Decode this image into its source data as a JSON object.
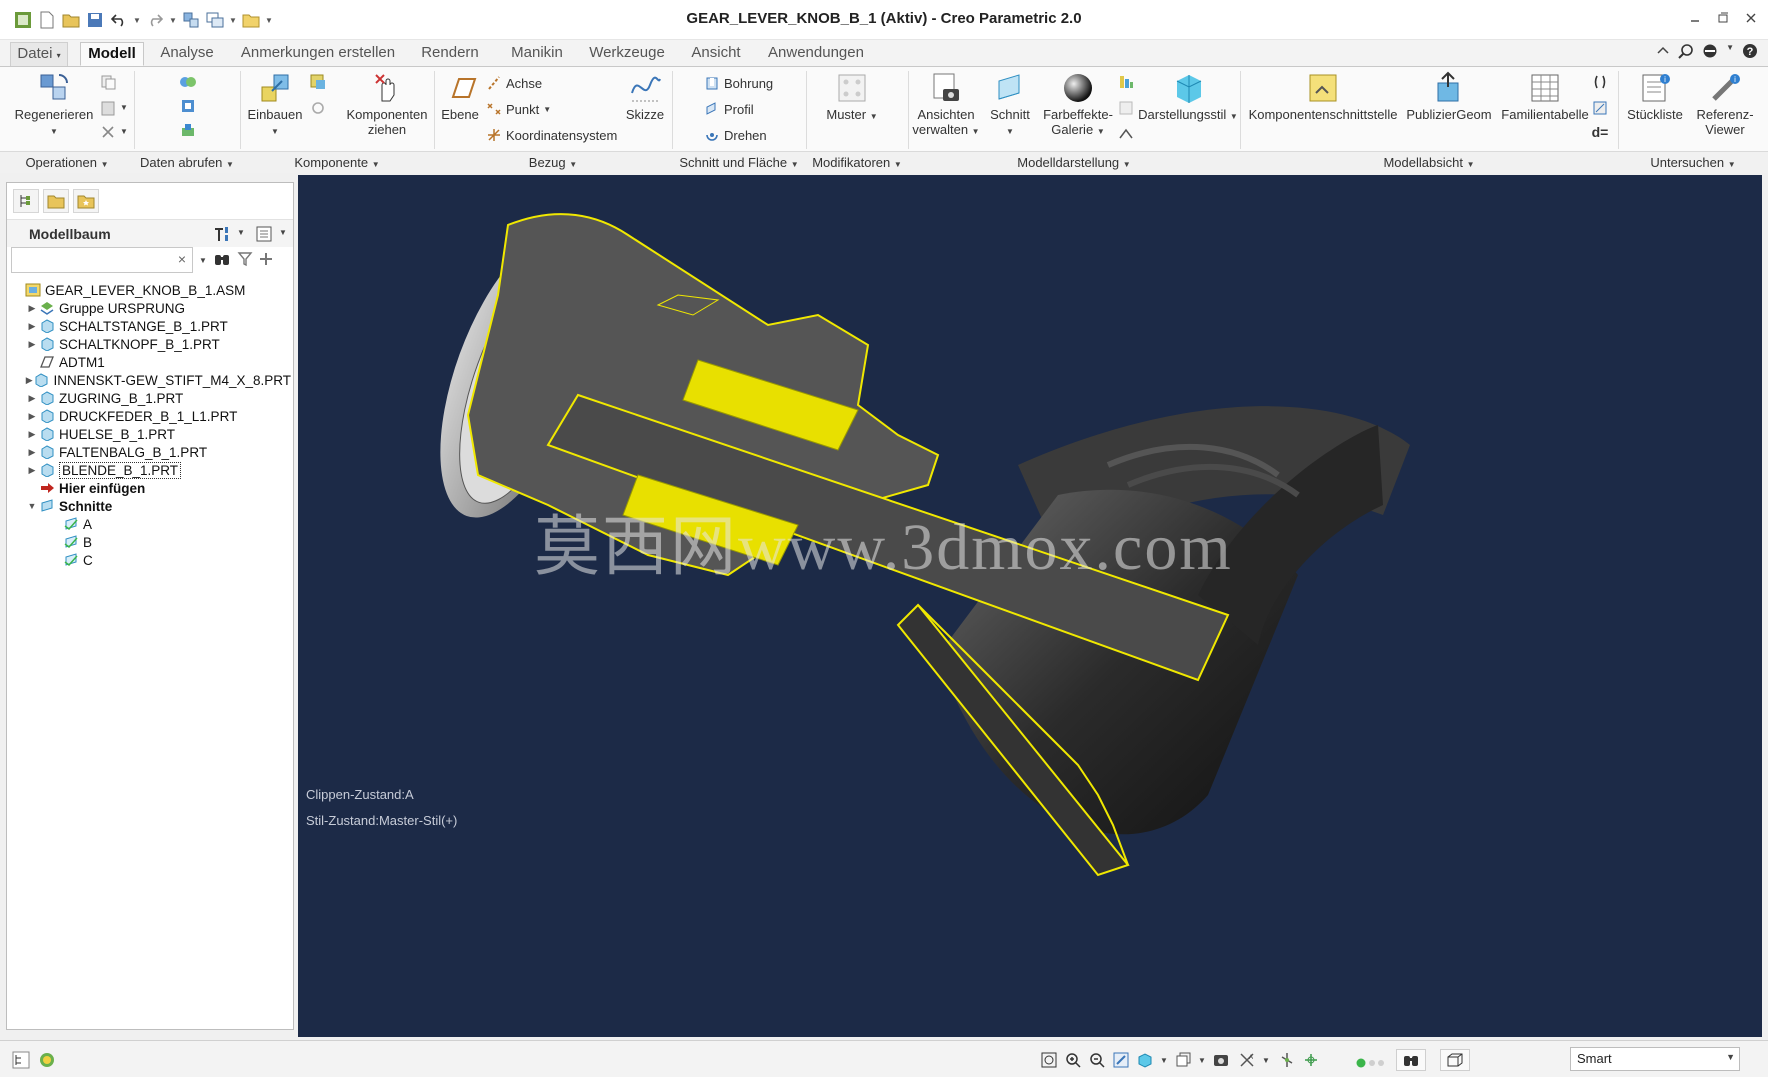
{
  "window": {
    "title": "GEAR_LEVER_KNOB_B_1 (Aktiv) - Creo Parametric 2.0",
    "app_icon": "creo-app-icon",
    "quick_access": [
      "new-icon",
      "open-icon",
      "save-icon",
      "undo-icon",
      "redo-icon",
      "regenerate-icon",
      "windows-icon",
      "folder-icon"
    ]
  },
  "ribbon": {
    "tabs": [
      "Datei",
      "Modell",
      "Analyse",
      "Anmerkungen erstellen",
      "Rendern",
      "Manikin",
      "Werkzeuge",
      "Ansicht",
      "Anwendungen"
    ],
    "active_tab": "Modell",
    "buttons": {
      "regenerieren": "Regenerieren",
      "einbauen": "Einbauen",
      "komponenten_ziehen_1": "Komponenten",
      "komponenten_ziehen_2": "ziehen",
      "ebene": "Ebene",
      "achse": "Achse",
      "punkt": "Punkt",
      "koordinatensystem": "Koordinatensystem",
      "skizze": "Skizze",
      "bohrung": "Bohrung",
      "profil": "Profil",
      "drehen": "Drehen",
      "muster": "Muster",
      "ansichten_1": "Ansichten",
      "ansichten_2": "verwalten",
      "schnitt": "Schnitt",
      "farbeffekte_1": "Farbeffekte-",
      "farbeffekte_2": "Galerie",
      "darstellungsstil": "Darstellungsstil",
      "komponentenschnittstelle": "Komponentenschnittstelle",
      "publiziergeom": "PublizierGeom",
      "familientabelle": "Familientabelle",
      "stueckliste": "Stückliste",
      "referenz_1": "Referenz-",
      "referenz_2": "Viewer",
      "d_equals": "d="
    },
    "groups": [
      "Operationen",
      "Daten abrufen",
      "Komponente",
      "Bezug",
      "Schnitt und Fläche",
      "Modifikatoren",
      "Modelldarstellung",
      "Modellabsicht",
      "Untersuchen"
    ]
  },
  "model_tree": {
    "title": "Modellbaum",
    "search_value": "",
    "items": [
      {
        "label": "GEAR_LEVER_KNOB_B_1.ASM",
        "icon": "assembly-icon",
        "expander": ""
      },
      {
        "label": "Gruppe URSPRUNG",
        "icon": "group-icon",
        "expander": "▶"
      },
      {
        "label": "SCHALTSTANGE_B_1.PRT",
        "icon": "part-icon",
        "expander": "▶"
      },
      {
        "label": "SCHALTKNOPF_B_1.PRT",
        "icon": "part-icon",
        "expander": "▶"
      },
      {
        "label": "ADTM1",
        "icon": "datum-plane-icon",
        "expander": ""
      },
      {
        "label": "INNENSKT-GEW_STIFT_M4_X_8.PRT",
        "icon": "part-icon",
        "expander": "▶"
      },
      {
        "label": "ZUGRING_B_1.PRT",
        "icon": "part-icon",
        "expander": "▶"
      },
      {
        "label": "DRUCKFEDER_B_1_L1.PRT",
        "icon": "part-icon",
        "expander": "▶"
      },
      {
        "label": "HUELSE_B_1.PRT",
        "icon": "part-icon",
        "expander": "▶"
      },
      {
        "label": "FALTENBALG_B_1.PRT",
        "icon": "part-icon",
        "expander": "▶"
      },
      {
        "label": "BLENDE_B_1.PRT",
        "icon": "part-icon",
        "expander": "▶"
      },
      {
        "label": "Hier einfügen",
        "icon": "insert-here-icon",
        "expander": ""
      },
      {
        "label": "Schnitte",
        "icon": "section-folder-icon",
        "expander": "▼"
      },
      {
        "label": "A",
        "icon": "section-icon",
        "expander": ""
      },
      {
        "label": "B",
        "icon": "section-icon",
        "expander": ""
      },
      {
        "label": "C",
        "icon": "section-icon",
        "expander": ""
      }
    ]
  },
  "viewport": {
    "clip_state": "Clippen-Zustand:A",
    "style_state": "Stil-Zustand:Master-Stil(+)",
    "watermark": "莫西网www.3dmox.com",
    "background": "#1c2a47",
    "outline_color": "#f0e800",
    "part_color": "#4d4d4d"
  },
  "statusbar": {
    "selection_filter": "Smart"
  }
}
